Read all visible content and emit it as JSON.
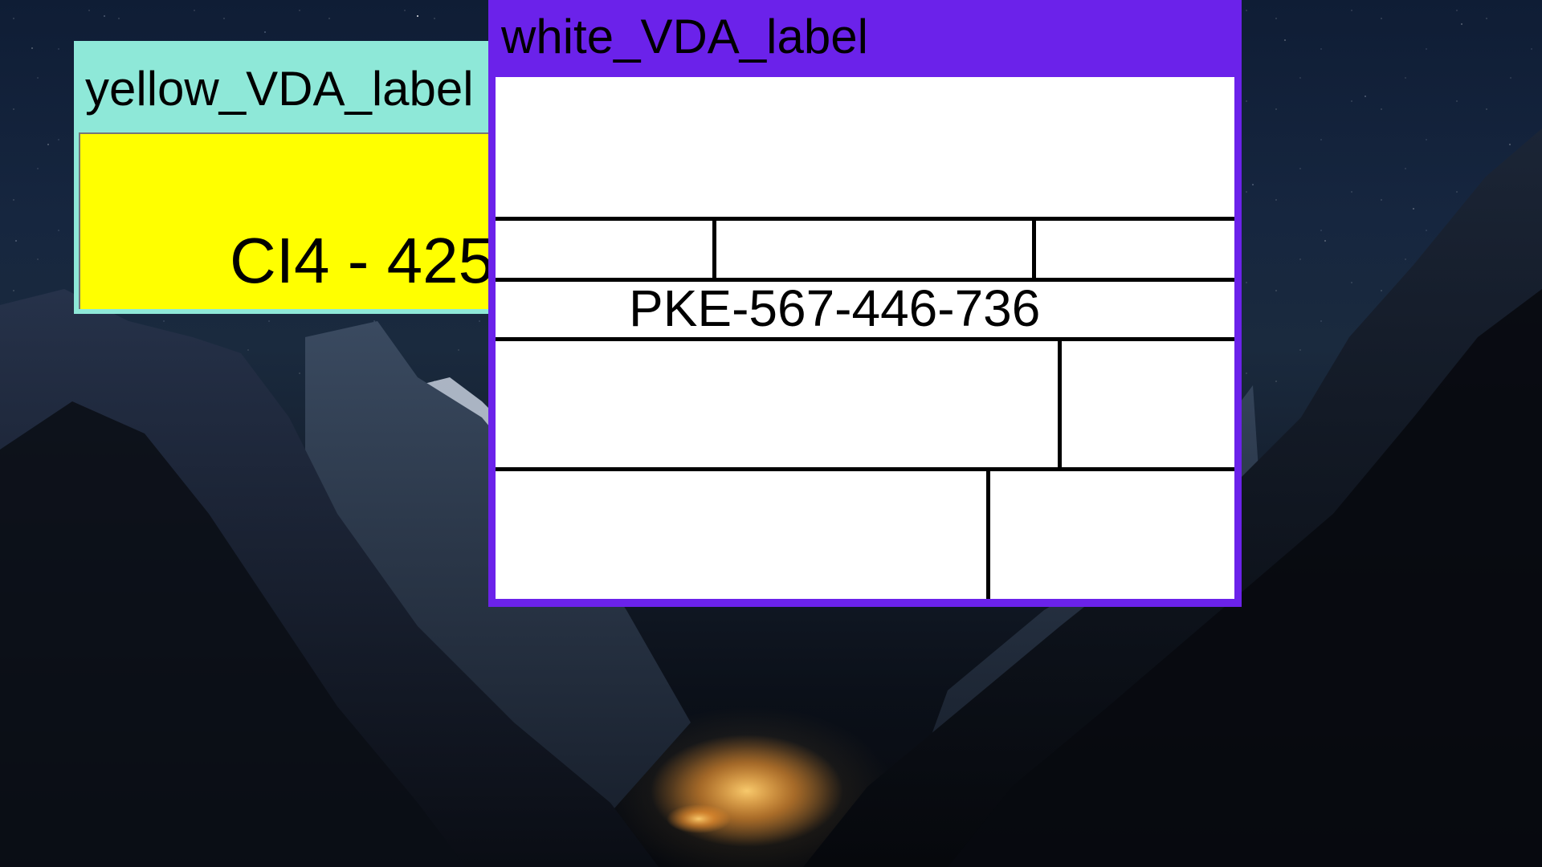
{
  "desktop": {
    "wallpaper": "night-mountain-valley"
  },
  "windows": {
    "yellow": {
      "title": "yellow_VDA_label",
      "content_text": "CI4 - 425",
      "title_bar_color": "#8ee8d8",
      "client_color": "#ffff00"
    },
    "white": {
      "title": "white_VDA_label",
      "content_text": "PKE-567-446-736",
      "title_bar_color": "#6b22ea",
      "client_color": "#ffffff"
    }
  }
}
